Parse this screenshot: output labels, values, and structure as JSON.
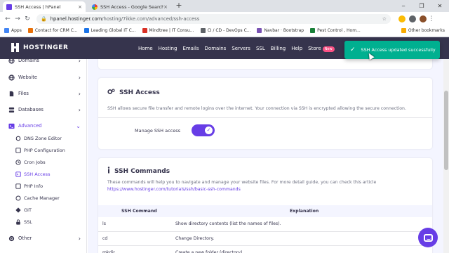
{
  "browser": {
    "tabs": [
      {
        "label": "SSH Access | hPanel",
        "active": true,
        "close": "×"
      },
      {
        "label": "SSH Access - Google Search",
        "active": false,
        "close": "×"
      }
    ],
    "new_tab": "+",
    "window_controls": [
      "‒",
      "❐",
      "✕"
    ],
    "url_host": "hpanel.hostinger.com",
    "url_path": "/hosting/7ikke.com/advanced/ssh-access",
    "bookmarks": [
      {
        "label": "Apps",
        "color": "#4285f4"
      },
      {
        "label": "Contact for CRM C...",
        "color": "#e8710a"
      },
      {
        "label": "Leading Global IT C...",
        "color": "#1a73e8"
      },
      {
        "label": "Mindtree | IT Consu...",
        "color": "#d93025"
      },
      {
        "label": "CI / CD - DevOps C...",
        "color": "#5f6368"
      },
      {
        "label": "Navbar · Bootstrap",
        "color": "#7952b3"
      },
      {
        "label": "Pest Control , Hom...",
        "color": "#188038"
      }
    ],
    "other_bookmarks": "Other bookmarks"
  },
  "header": {
    "logo": "HOSTINGER",
    "nav": [
      "Home",
      "Hosting",
      "Emails",
      "Domains",
      "Servers",
      "SSL",
      "Billing",
      "Help",
      "Store"
    ],
    "new_badge": "New"
  },
  "sidebar": {
    "items": [
      {
        "label": "Domains",
        "chevron": "›"
      },
      {
        "label": "Website",
        "chevron": "›"
      },
      {
        "label": "Files",
        "chevron": "›"
      },
      {
        "label": "Databases",
        "chevron": "›"
      },
      {
        "label": "Advanced",
        "chevron": "⌄"
      }
    ],
    "subitems": [
      "DNS Zone Editor",
      "PHP Configuration",
      "Cron Jobs",
      "SSH Access",
      "PHP Info",
      "Cache Manager",
      "GIT",
      "SSL"
    ],
    "other": {
      "label": "Other",
      "chevron": "›"
    }
  },
  "ssh_access": {
    "title": "SSH Access",
    "description": "SSH allows secure file transfer and remote logins over the internet. Your connection via SSH is encrypted allowing the secure connection.",
    "toggle_label": "Manage SSH access",
    "toggle_on": true
  },
  "ssh_commands": {
    "title": "SSH Commands",
    "description": "These commands will help you to navigate and manage your website files. For more detail guide, you can check this article",
    "link": "https://www.hostinger.com/tutorials/ssh/basic-ssh-commands",
    "columns": [
      "SSH Command",
      "Explanation"
    ],
    "rows": [
      {
        "command": "ls",
        "explanation": "Show directory contents (list the names of files)."
      },
      {
        "command": "cd",
        "explanation": "Change Directory."
      },
      {
        "command": "mkdir",
        "explanation": "Create a new folder (directory)."
      }
    ]
  },
  "toast": {
    "message": "SSH Access updated successfully",
    "color": "#00b090"
  },
  "colors": {
    "accent": "#673de6",
    "header_bg": "#36344d",
    "page_bg": "#f4f5ff"
  }
}
